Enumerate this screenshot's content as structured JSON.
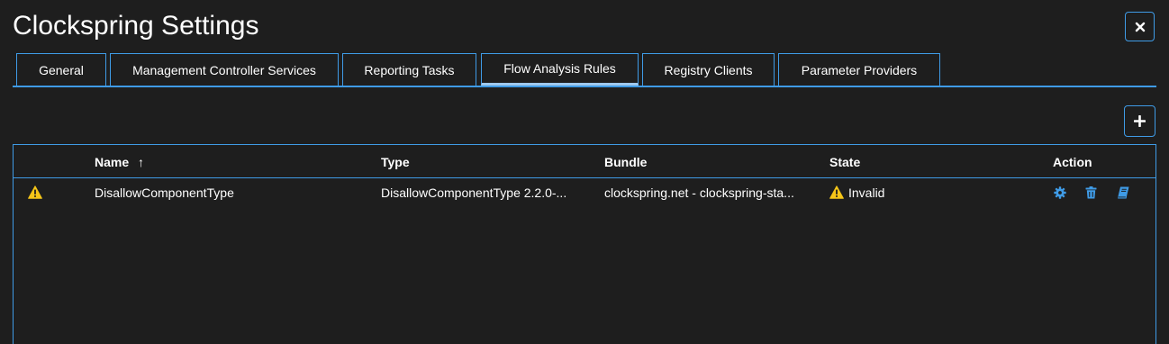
{
  "window": {
    "title": "Clockspring Settings",
    "close_icon": "close-icon"
  },
  "tabs": [
    {
      "label": "General",
      "active": false
    },
    {
      "label": "Management Controller Services",
      "active": false
    },
    {
      "label": "Reporting Tasks",
      "active": false
    },
    {
      "label": "Flow Analysis Rules",
      "active": true
    },
    {
      "label": "Registry Clients",
      "active": false
    },
    {
      "label": "Parameter Providers",
      "active": false
    }
  ],
  "toolbar": {
    "add_icon": "plus-icon"
  },
  "table": {
    "columns": {
      "name": "Name",
      "sort_indicator": "↑",
      "type": "Type",
      "bundle": "Bundle",
      "state": "State",
      "action": "Action"
    },
    "rows": [
      {
        "status_icon": "warning-icon",
        "name": "DisallowComponentType",
        "type": "DisallowComponentType 2.2.0-...",
        "bundle": "clockspring.net - clockspring-sta...",
        "state": "Invalid",
        "state_icon": "warning-icon",
        "actions": [
          "gear-icon",
          "trash-icon",
          "book-icon"
        ]
      }
    ]
  },
  "colors": {
    "background": "#1e1e1e",
    "accent": "#3f9be6",
    "warning": "#f5c518",
    "action_icon": "#3f9be6",
    "text": "#ffffff"
  }
}
